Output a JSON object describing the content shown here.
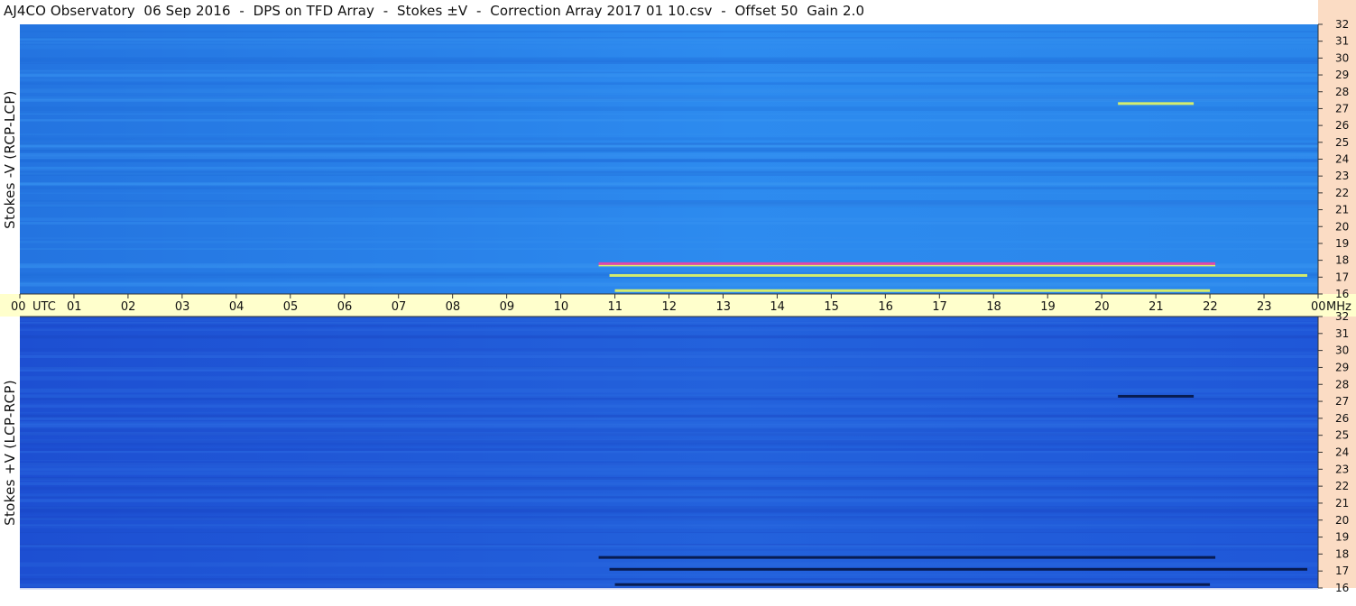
{
  "title": "AJ4CO Observatory  06 Sep 2016  -  DPS on TFD Array  -  Stokes ±V  -  Correction Array 2017 01 10.csv  -  Offset 50  Gain 2.0",
  "colors": {
    "time_axis_bg": "#ffffcc",
    "freq_axis_bg": "#fbdcc4",
    "upper_field": "#2a86ea",
    "lower_field": "#1f57d8",
    "burst_hot": "#ff3aa0",
    "burst_warm": "#f2ff58",
    "burst_dark": "#04113a"
  },
  "chart_data": [
    {
      "type": "heatmap",
      "title": "",
      "ylabel": "Stokes -V (RCP-LCP)",
      "xlabel": "",
      "x_ticks": [
        "00 UTC",
        "01",
        "02",
        "03",
        "04",
        "05",
        "06",
        "07",
        "08",
        "09",
        "10",
        "11",
        "12",
        "13",
        "14",
        "15",
        "16",
        "17",
        "18",
        "19",
        "20",
        "21",
        "22",
        "23",
        "00"
      ],
      "x_unit_label": "UTC",
      "y_ticks": [
        32,
        31,
        30,
        29,
        28,
        27,
        26,
        25,
        24,
        23,
        22,
        21,
        20,
        19,
        18,
        17,
        16
      ],
      "y_unit_label": "MHz",
      "xlim": [
        0,
        24
      ],
      "ylim": [
        16,
        32
      ],
      "bursts": [
        {
          "t_start": 10.7,
          "t_end": 22.1,
          "freq": 17.8,
          "intensity": "hot"
        },
        {
          "t_start": 10.9,
          "t_end": 23.8,
          "freq": 17.1,
          "intensity": "warm"
        },
        {
          "t_start": 11.0,
          "t_end": 22.0,
          "freq": 16.2,
          "intensity": "warm"
        },
        {
          "t_start": 20.3,
          "t_end": 21.7,
          "freq": 27.3,
          "intensity": "warm"
        }
      ]
    },
    {
      "type": "heatmap",
      "title": "",
      "ylabel": "Stokes +V (LCP-RCP)",
      "xlabel": "",
      "x_ticks": [
        "00 UTC",
        "01",
        "02",
        "03",
        "04",
        "05",
        "06",
        "07",
        "08",
        "09",
        "10",
        "11",
        "12",
        "13",
        "14",
        "15",
        "16",
        "17",
        "18",
        "19",
        "20",
        "21",
        "22",
        "23",
        "00"
      ],
      "x_unit_label": "UTC",
      "y_ticks": [
        32,
        31,
        30,
        29,
        28,
        27,
        26,
        25,
        24,
        23,
        22,
        21,
        20,
        19,
        18,
        17,
        16
      ],
      "y_unit_label": "MHz",
      "xlim": [
        0,
        24
      ],
      "ylim": [
        16,
        32
      ],
      "bursts": [
        {
          "t_start": 10.7,
          "t_end": 22.1,
          "freq": 17.8,
          "intensity": "dark"
        },
        {
          "t_start": 10.9,
          "t_end": 23.8,
          "freq": 17.1,
          "intensity": "dark"
        },
        {
          "t_start": 11.0,
          "t_end": 22.0,
          "freq": 16.2,
          "intensity": "dark"
        },
        {
          "t_start": 20.3,
          "t_end": 21.7,
          "freq": 27.3,
          "intensity": "dark"
        }
      ]
    }
  ]
}
